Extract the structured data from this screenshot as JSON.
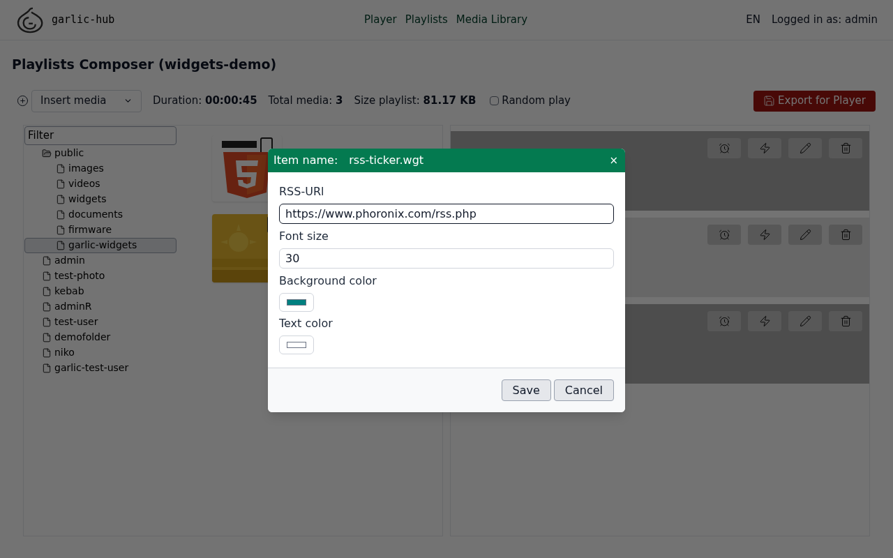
{
  "header": {
    "logo_text": "garlic-hub",
    "nav": [
      {
        "label": "Player"
      },
      {
        "label": "Playlists"
      },
      {
        "label": "Media Library"
      }
    ],
    "language": "EN",
    "user": "Logged in as: admin"
  },
  "page_title": "Playlists Composer (widgets-demo)",
  "toolbar": {
    "insert_select": "Insert media",
    "stats": [
      {
        "label": "Duration:",
        "value": "00:00:45"
      },
      {
        "label": "Total media:",
        "value": "3"
      },
      {
        "label": "Size playlist:",
        "value": "81.17 KB"
      }
    ],
    "random_play": {
      "label": "Random play",
      "checked": false
    },
    "export_button": "Export for Player"
  },
  "media_library": {
    "filter": {
      "placeholder": "Filter"
    },
    "tree": [
      {
        "label": "public",
        "kind": "folder",
        "selected": false,
        "children": [
          {
            "label": "images",
            "kind": "file",
            "selected": false
          },
          {
            "label": "videos",
            "kind": "file",
            "selected": false
          },
          {
            "label": "widgets",
            "kind": "file",
            "selected": false
          },
          {
            "label": "documents",
            "kind": "file",
            "selected": false
          },
          {
            "label": "firmware",
            "kind": "file",
            "selected": false
          },
          {
            "label": "garlic-widgets",
            "kind": "file",
            "selected": true
          }
        ]
      },
      {
        "label": "admin",
        "kind": "file",
        "selected": false
      },
      {
        "label": "test-photo",
        "kind": "file",
        "selected": false
      },
      {
        "label": "kebab",
        "kind": "file",
        "selected": false
      },
      {
        "label": "adminR",
        "kind": "file",
        "selected": false
      },
      {
        "label": "test-user",
        "kind": "file",
        "selected": false
      },
      {
        "label": "demofolder",
        "kind": "file",
        "selected": false
      },
      {
        "label": "niko",
        "kind": "file",
        "selected": false
      },
      {
        "label": "garlic-test-user",
        "kind": "file",
        "selected": false
      }
    ]
  },
  "playlist_items": [
    {
      "kind": "item"
    },
    {
      "kind": "item"
    },
    {
      "kind": "item"
    }
  ],
  "dialog": {
    "title_label": "Item name:",
    "title_value": "rss-ticker.wgt",
    "close": "×",
    "fields": [
      {
        "label": "RSS-URl",
        "kind": "text",
        "value": "https://www.phoronix.com/rss.php",
        "focused": true
      },
      {
        "label": "Font size",
        "kind": "text",
        "value": "30",
        "focused": false
      },
      {
        "label": "Background color",
        "kind": "color",
        "color": "#008080"
      },
      {
        "label": "Text color",
        "kind": "color",
        "color": "#ffffff"
      }
    ],
    "buttons": [
      "Save",
      "Cancel"
    ]
  }
}
